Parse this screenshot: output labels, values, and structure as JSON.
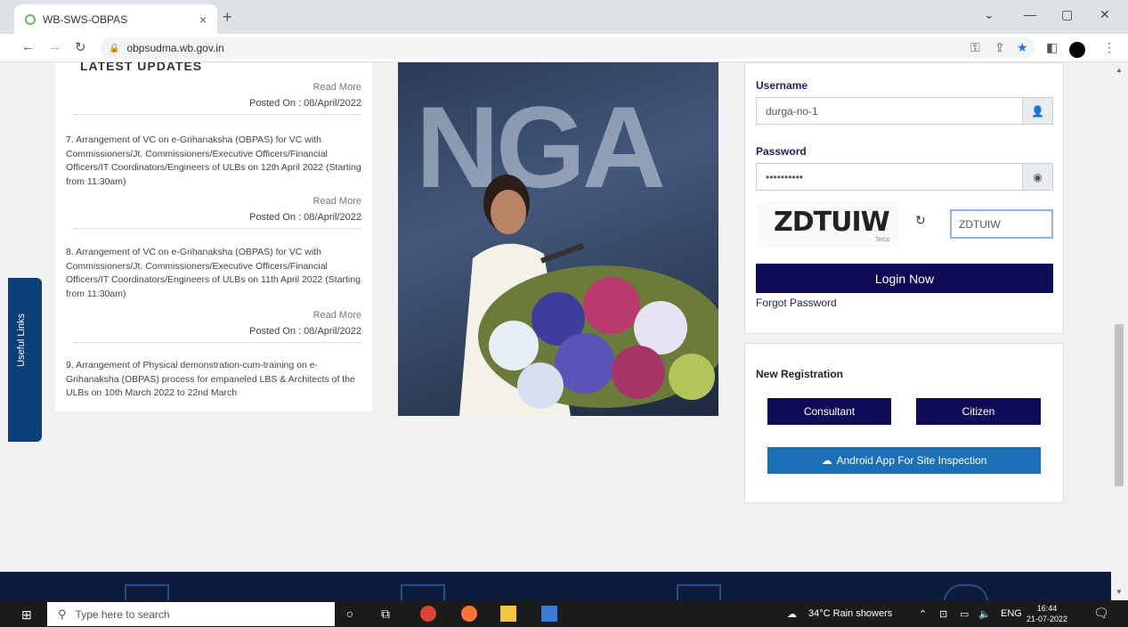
{
  "browser": {
    "tab_title": "WB-SWS-OBPAS",
    "tab_close": "×",
    "new_tab": "+",
    "url": "obpsudma.wb.gov.in",
    "min": "—",
    "restore": "▢",
    "close": "✕",
    "chevron": "⌄"
  },
  "updates": {
    "heading": "LATEST UPDATES",
    "read_more": "Read More",
    "items": [
      {
        "posted": "Posted On : 08/April/2022"
      },
      {
        "text": "7. Arrangement of VC on e-Grihanaksha (OBPAS) for VC with Commissioners/Jt. Commissioners/Executive Officers/Financial Officers/IT Coordinators/Engineers of ULBs on 12th April 2022 (Starting from 11:30am)",
        "posted": "Posted On : 08/April/2022"
      },
      {
        "text": "8. Arrangement of VC on e-Grihanaksha (OBPAS) for VC with Commissioners/Jt. Commissioners/Executive Officers/Financial Officers/IT Coordinators/Engineers of ULBs on 11th April 2022 (Starting from 11:30am)",
        "posted": "Posted On : 08/April/2022"
      },
      {
        "text": "9. Arrangement of Physical demonstration-cum-training on e-Grihanaksha (OBPAS) process for empaneled LBS & Architects of the ULBs on 10th March 2022 to 22nd March"
      }
    ]
  },
  "side_tab": "Useful Links",
  "photo_letters": "NGA",
  "login": {
    "username_label": "Username",
    "username_value": "durga-no-1",
    "password_label": "Password",
    "password_value": "••••••••••",
    "captcha_text": "ZDTUIW",
    "captcha_sub": "Telco",
    "captcha_input": "ZDTUIW",
    "login_button": "Login Now",
    "forgot": "Forgot Password"
  },
  "registration": {
    "heading": "New Registration",
    "consultant": "Consultant",
    "citizen": "Citizen",
    "android": "Android App For Site Inspection"
  },
  "taskbar": {
    "search_placeholder": "Type here to search",
    "weather": "34°C  Rain showers",
    "lang": "ENG",
    "time": "16:44",
    "date": "21-07-2022"
  }
}
